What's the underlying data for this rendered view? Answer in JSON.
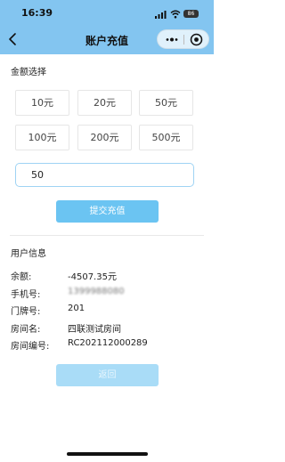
{
  "status_bar": {
    "time": "16:39",
    "battery": "86"
  },
  "navbar": {
    "title": "账户充值"
  },
  "recharge": {
    "section_title": "金额选择",
    "amounts": [
      "10元",
      "20元",
      "50元",
      "100元",
      "200元",
      "500元"
    ],
    "input_value": "50",
    "submit_label": "提交充值"
  },
  "user_info": {
    "section_title": "用户信息",
    "fields": [
      {
        "label": "余额:",
        "value": "-4507.35元"
      },
      {
        "label": "手机号:",
        "value": "1399988080"
      },
      {
        "label": "门牌号:",
        "value": "201"
      },
      {
        "label": "房间名:",
        "value": "四联测试房间"
      },
      {
        "label": "房间编号:",
        "value": "RC202112000289"
      }
    ]
  },
  "back_button_label": "返回",
  "colors": {
    "header": "#83c5f0",
    "accent": "#6bc4f2",
    "input_border": "#9fd3f4"
  }
}
